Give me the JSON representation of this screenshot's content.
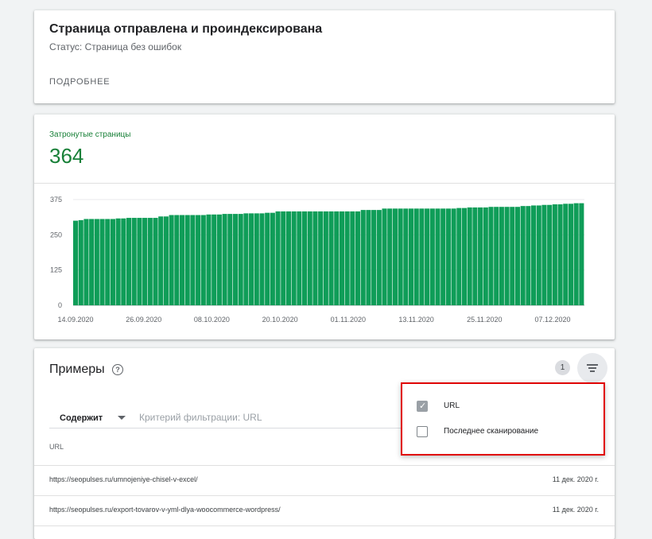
{
  "status_card": {
    "title": "Страница отправлена и проиндексирована",
    "subtitle": "Статус: Страница без ошибок",
    "details_link": "ПОДРОБНЕЕ"
  },
  "metric": {
    "label": "Затронутые страницы",
    "value": "364"
  },
  "colors": {
    "bar": "#0f9d58",
    "metric": "#188038",
    "popup_border": "#e00000"
  },
  "chart_data": {
    "type": "bar",
    "ylim": [
      0,
      375
    ],
    "yticks": [
      "0",
      "125",
      "250",
      "375"
    ],
    "xtick_labels": [
      "14.09.2020",
      "26.09.2020",
      "08.10.2020",
      "20.10.2020",
      "01.11.2020",
      "13.11.2020",
      "25.11.2020",
      "07.12.2020"
    ],
    "series": [
      {
        "values": [
          300,
          302,
          306,
          306,
          306,
          306,
          306,
          306,
          308,
          308,
          310,
          310,
          310,
          310,
          310,
          310,
          315,
          315,
          320,
          320,
          320,
          320,
          320,
          320,
          320,
          322,
          322,
          322,
          324,
          324,
          324,
          324,
          326,
          326,
          326,
          326,
          328,
          328,
          333,
          333,
          333,
          333,
          333,
          333,
          333,
          333,
          333,
          333,
          333,
          333,
          333,
          333,
          333,
          333,
          338,
          338,
          338,
          338,
          343,
          343,
          343,
          343,
          343,
          343,
          343,
          343,
          343,
          343,
          343,
          343,
          343,
          343,
          345,
          345,
          347,
          347,
          347,
          347,
          349,
          349,
          349,
          349,
          349,
          349,
          352,
          352,
          354,
          354,
          356,
          356,
          358,
          358,
          360,
          360,
          362,
          362
        ]
      }
    ],
    "grid": true
  },
  "examples": {
    "title": "Примеры",
    "help_icon": "?",
    "filter_count": "1",
    "filter_select": "Содержит",
    "filter_placeholder": "Критерий фильтрации: URL",
    "column_header": "URL",
    "rows": [
      {
        "url": "https://seopulses.ru/umnojeniye-chisel-v-excel/",
        "date": "11 дек. 2020 г."
      },
      {
        "url": "https://seopulses.ru/export-tovarov-v-yml-dlya-woocommerce-wordpress/",
        "date": "11 дек. 2020 г."
      }
    ]
  },
  "popup": {
    "options": [
      {
        "label": "URL",
        "checked": true
      },
      {
        "label": "Последнее сканирование",
        "checked": false
      }
    ]
  }
}
